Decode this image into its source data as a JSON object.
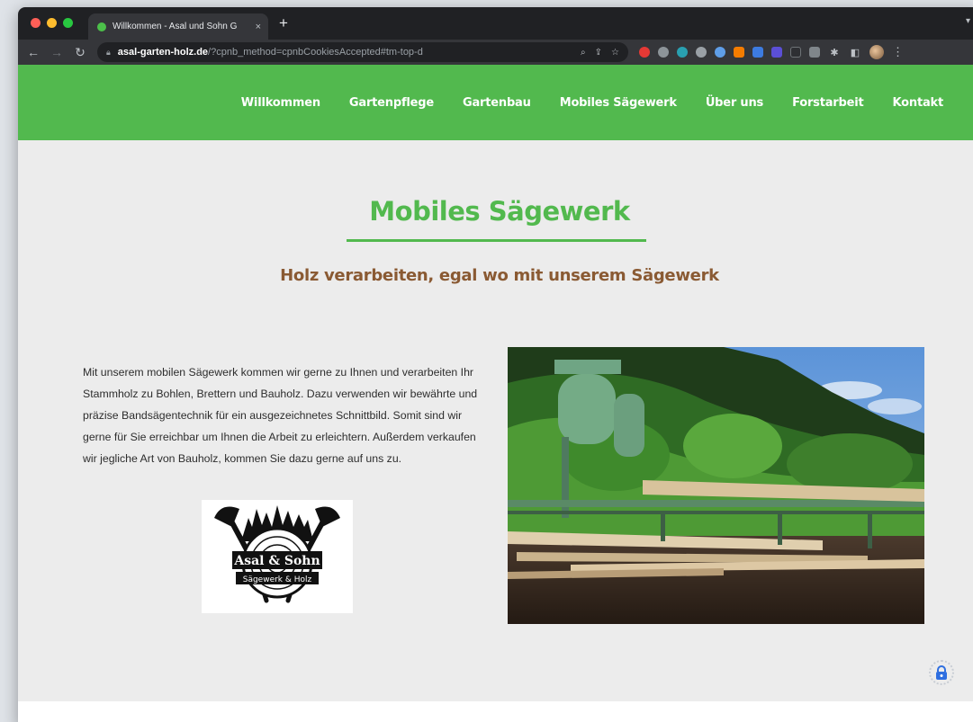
{
  "browser": {
    "tab_title": "Willkommen - Asal und Sohn G",
    "tab_close": "×",
    "new_tab": "+",
    "url_domain": "asal-garten-holz.de",
    "url_rest": "/?cpnb_method=cpnbCookiesAccepted#tm-top-d",
    "colors": {
      "chrome_dark": "#202124",
      "chrome_mid": "#35363a"
    }
  },
  "nav": {
    "items": [
      "Willkommen",
      "Gartenpflege",
      "Gartenbau",
      "Mobiles Sägewerk",
      "Über uns",
      "Forstarbeit",
      "Kontakt"
    ],
    "color": "#52b94e"
  },
  "page": {
    "title": "Mobiles Sägewerk",
    "subtitle": "Holz verarbeiten, egal wo mit unserem Sägewerk",
    "body": "Mit unserem mobilen Sägewerk kommen wir gerne zu Ihnen und verarbeiten Ihr Stammholz zu Bohlen, Brettern und Bauholz. Dazu verwenden wir bewährte und präzise Bandsägentechnik für ein ausgezeichnetes Schnittbild. Somit sind wir gerne für Sie erreichbar um Ihnen die Arbeit zu erleichtern. Außerdem verkaufen wir jegliche Art von Bauholz, kommen Sie dazu gerne auf uns zu.",
    "title_color": "#52b94e",
    "subtitle_color": "#8a5a33"
  },
  "logo": {
    "line1": "Asal & Sohn",
    "line2": "Sägewerk & Holz"
  },
  "icons": [
    "lock-icon",
    "search-icon",
    "share-icon",
    "star-icon",
    "puzzle-icon",
    "sidebar-icon",
    "kebab-icon",
    "cookie-lock-icon"
  ]
}
